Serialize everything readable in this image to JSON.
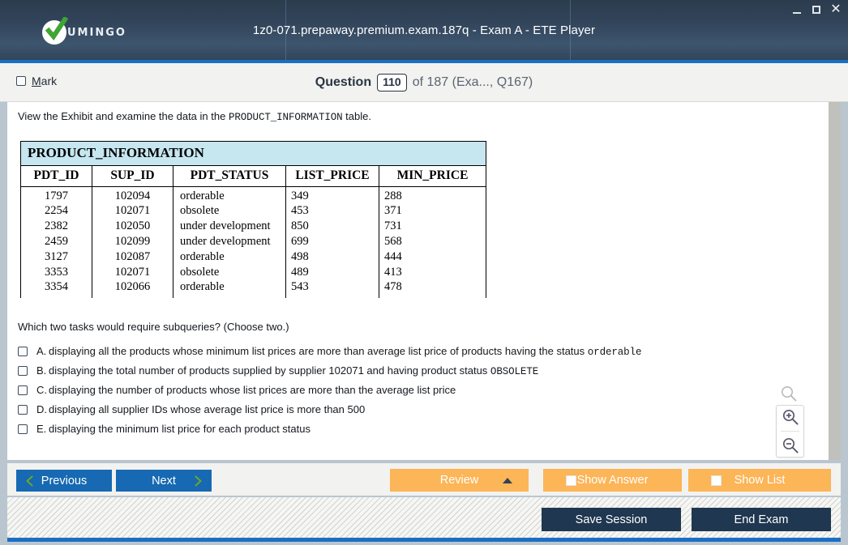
{
  "window": {
    "title": "1z0-071.prepaway.premium.exam.187q - Exam A - ETE Player",
    "logo_text": "UMINGO",
    "controls": {
      "minimize": "minimize-icon",
      "maximize": "maximize-icon",
      "close": "close-icon"
    }
  },
  "question_bar": {
    "mark_label_prefix": "M",
    "mark_label_rest": "ark",
    "question_label": "Question",
    "question_number": "110",
    "of_text": "of 187 (Exa..., Q167)"
  },
  "content": {
    "stem_before": "View the Exhibit and examine the data in the ",
    "stem_mono": "PRODUCT_INFORMATION",
    "stem_after": " table.",
    "question_text": "Which two tasks would require subqueries? (Choose two.)"
  },
  "exhibit": {
    "title": "PRODUCT_INFORMATION",
    "columns": [
      "PDT_ID",
      "SUP_ID",
      "PDT_STATUS",
      "LIST_PRICE",
      "MIN_PRICE"
    ],
    "rows": [
      [
        "1797",
        "102094",
        "orderable",
        "349",
        "288"
      ],
      [
        "2254",
        "102071",
        "obsolete",
        "453",
        "371"
      ],
      [
        "2382",
        "102050",
        "under development",
        "850",
        "731"
      ],
      [
        "2459",
        "102099",
        "under development",
        "699",
        "568"
      ],
      [
        "3127",
        "102087",
        "orderable",
        "498",
        "444"
      ],
      [
        "3353",
        "102071",
        "obsolete",
        "489",
        "413"
      ],
      [
        "3354",
        "102066",
        "orderable",
        "543",
        "478"
      ]
    ]
  },
  "options": [
    {
      "letter": "A.",
      "text_before": "displaying all the products whose minimum list prices are more than average list price of products having the status ",
      "text_mono": "orderable",
      "text_after": ""
    },
    {
      "letter": "B.",
      "text_before": "displaying the total number of products supplied by supplier 102071 and having product status ",
      "text_mono": "OBSOLETE",
      "text_after": ""
    },
    {
      "letter": "C.",
      "text_before": "displaying the number of products whose list prices are more than the average list price",
      "text_mono": "",
      "text_after": ""
    },
    {
      "letter": "D.",
      "text_before": "displaying all supplier IDs whose average list price is more than 500",
      "text_mono": "",
      "text_after": ""
    },
    {
      "letter": "E.",
      "text_before": "displaying the minimum list price for each product status",
      "text_mono": "",
      "text_after": ""
    }
  ],
  "zoom_widget": {
    "magnifier": "magnifier-icon",
    "zoom_in": "zoom-in-icon",
    "zoom_out": "zoom-out-icon"
  },
  "action_bar": {
    "previous": "Previous",
    "next": "Next",
    "review": "Review",
    "show_answer": "Show Answer",
    "show_list": "Show List"
  },
  "footer": {
    "save_session": "Save Session",
    "end_exam": "End Exam"
  },
  "colors": {
    "titlebar_dark": "#32445a",
    "accent_blue": "#1a6fc4",
    "button_blue": "#1669b2",
    "button_orange": "#fcb557",
    "button_dark": "#1f3750",
    "table_header_blue": "#c6e6f0",
    "check_green": "#3fa535"
  }
}
